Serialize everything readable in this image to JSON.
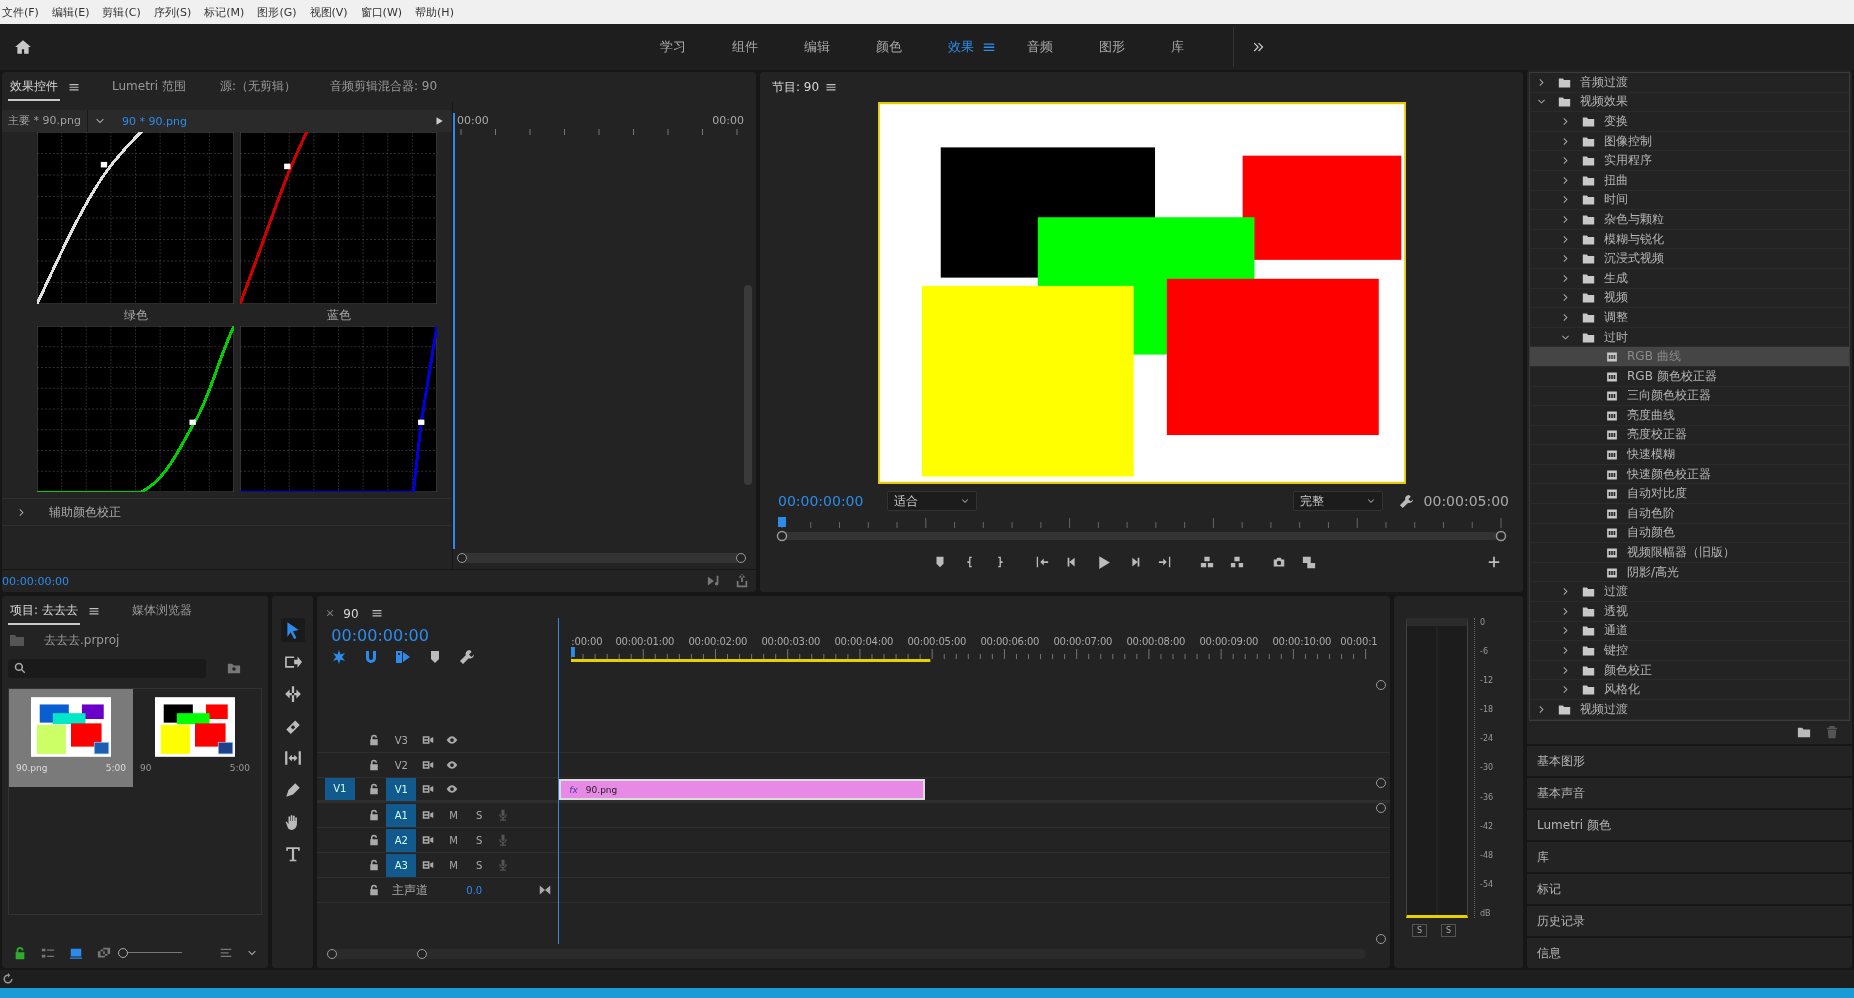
{
  "menu": [
    "文件(F)",
    "编辑(E)",
    "剪辑(C)",
    "序列(S)",
    "标记(M)",
    "图形(G)",
    "视图(V)",
    "窗口(W)",
    "帮助(H)"
  ],
  "workspaces": [
    {
      "label": "学习",
      "selected": false
    },
    {
      "label": "组件",
      "selected": false
    },
    {
      "label": "编辑",
      "selected": false
    },
    {
      "label": "颜色",
      "selected": false
    },
    {
      "label": "效果",
      "selected": true
    },
    {
      "label": "音频",
      "selected": false
    },
    {
      "label": "图形",
      "selected": false
    },
    {
      "label": "库",
      "selected": false
    }
  ],
  "effect_controls": {
    "tabs": [
      {
        "label": "效果控件",
        "selected": true
      },
      {
        "label": "Lumetri 范围",
        "selected": false
      },
      {
        "label": "源:（无剪辑）",
        "selected": false
      },
      {
        "label": "音频剪辑混合器: 90",
        "selected": false
      }
    ],
    "master_clip": "主要 * 90.png",
    "sequence_clip": "90 * 90.png",
    "ruler_start": "00:00",
    "ruler_end": "00:00",
    "curves": [
      {
        "kind": "master",
        "color": "#e0e0e0"
      },
      {
        "kind": "red",
        "color": "#d00000"
      },
      {
        "kind": "green",
        "label": "绿色",
        "color": "#00d000"
      },
      {
        "kind": "blue",
        "label": "蓝色",
        "color": "#0000e0"
      }
    ],
    "section": {
      "label": "辅助颜色校正",
      "expanded": false
    },
    "timecode": "00:00:00:00"
  },
  "program": {
    "title": "节目: 90",
    "timecode": "00:00:00:00",
    "zoom": "适合",
    "quality": "完整",
    "duration": "00:00:05:00"
  },
  "effects": {
    "tree": [
      {
        "label": "音频过渡",
        "kind": "folder",
        "expanded": false,
        "selected": false
      },
      {
        "label": "视频效果",
        "kind": "folder",
        "expanded": true,
        "selected": false,
        "children": [
          {
            "label": "变换",
            "kind": "folder",
            "expanded": false,
            "selected": false
          },
          {
            "label": "图像控制",
            "kind": "folder",
            "expanded": false,
            "selected": false
          },
          {
            "label": "实用程序",
            "kind": "folder",
            "expanded": false,
            "selected": false
          },
          {
            "label": "扭曲",
            "kind": "folder",
            "expanded": false,
            "selected": false
          },
          {
            "label": "时间",
            "kind": "folder",
            "expanded": false,
            "selected": false
          },
          {
            "label": "杂色与颗粒",
            "kind": "folder",
            "expanded": false,
            "selected": false
          },
          {
            "label": "模糊与锐化",
            "kind": "folder",
            "expanded": false,
            "selected": false
          },
          {
            "label": "沉浸式视频",
            "kind": "folder",
            "expanded": false,
            "selected": false
          },
          {
            "label": "生成",
            "kind": "folder",
            "expanded": false,
            "selected": false
          },
          {
            "label": "视频",
            "kind": "folder",
            "expanded": false,
            "selected": false
          },
          {
            "label": "调整",
            "kind": "folder",
            "expanded": false,
            "selected": false
          },
          {
            "label": "过时",
            "kind": "folder",
            "expanded": true,
            "selected": false,
            "children": [
              {
                "label": "RGB 曲线",
                "kind": "effect",
                "selected": true
              },
              {
                "label": "RGB 颜色校正器",
                "kind": "effect",
                "selected": false
              },
              {
                "label": "三向颜色校正器",
                "kind": "effect",
                "selected": false
              },
              {
                "label": "亮度曲线",
                "kind": "effect",
                "selected": false
              },
              {
                "label": "亮度校正器",
                "kind": "effect",
                "selected": false
              },
              {
                "label": "快速模糊",
                "kind": "effect",
                "selected": false
              },
              {
                "label": "快速颜色校正器",
                "kind": "effect",
                "selected": false
              },
              {
                "label": "自动对比度",
                "kind": "effect",
                "selected": false
              },
              {
                "label": "自动色阶",
                "kind": "effect",
                "selected": false
              },
              {
                "label": "自动颜色",
                "kind": "effect",
                "selected": false
              },
              {
                "label": "视频限幅器（旧版）",
                "kind": "effect",
                "selected": false
              },
              {
                "label": "阴影/高光",
                "kind": "effect",
                "selected": false
              }
            ]
          },
          {
            "label": "过渡",
            "kind": "folder",
            "expanded": false,
            "selected": false
          },
          {
            "label": "透视",
            "kind": "folder",
            "expanded": false,
            "selected": false
          },
          {
            "label": "通道",
            "kind": "folder",
            "expanded": false,
            "selected": false
          },
          {
            "label": "键控",
            "kind": "folder",
            "expanded": false,
            "selected": false
          },
          {
            "label": "颜色校正",
            "kind": "folder",
            "expanded": false,
            "selected": false
          },
          {
            "label": "风格化",
            "kind": "folder",
            "expanded": false,
            "selected": false
          }
        ]
      },
      {
        "label": "视频过渡",
        "kind": "folder",
        "expanded": false,
        "selected": false
      }
    ]
  },
  "panels": [
    "基本图形",
    "基本声音",
    "Lumetri 颜色",
    "库",
    "标记",
    "历史记录",
    "信息"
  ],
  "project": {
    "tabs": [
      {
        "label": "项目: 去去去",
        "selected": true
      },
      {
        "label": "媒体浏览器",
        "selected": false
      }
    ],
    "file": "去去去.prproj",
    "zoom": {
      "level": 0
    },
    "items": [
      {
        "name": "90.png",
        "duration": "5:00",
        "kind": "clip",
        "selected": true
      },
      {
        "name": "90",
        "duration": "5:00",
        "kind": "sequence",
        "selected": false
      }
    ]
  },
  "timeline": {
    "title": "90",
    "timecode": "00:00:00:00",
    "ruler": [
      ":00:00",
      "00:00:01:00",
      "00:00:02:00",
      "00:00:03:00",
      "00:00:04:00",
      "00:00:05:00",
      "00:00:06:00",
      "00:00:07:00",
      "00:00:08:00",
      "00:00:09:00",
      "00:00:10:00",
      "00:00:1"
    ],
    "tracks": [
      {
        "kind": "video",
        "name": "V3",
        "targeted": false
      },
      {
        "kind": "video",
        "name": "V2",
        "targeted": false
      },
      {
        "kind": "video",
        "name": "V1",
        "source": "V1",
        "targeted": true,
        "clip": {
          "name": "90.png",
          "badge": "fx"
        }
      },
      {
        "kind": "audio",
        "name": "A1",
        "targeted": true,
        "mute": "M",
        "solo": "S"
      },
      {
        "kind": "audio",
        "name": "A2",
        "targeted": true,
        "mute": "M",
        "solo": "S"
      },
      {
        "kind": "audio",
        "name": "A3",
        "targeted": true,
        "mute": "M",
        "solo": "S"
      },
      {
        "kind": "master",
        "name": "主声道",
        "value": "0.0"
      }
    ]
  },
  "meter": {
    "scale": [
      "0",
      "-6",
      "-12",
      "-18",
      "-24",
      "-30",
      "-36",
      "-42",
      "-48",
      "-54",
      "dB"
    ],
    "solo": [
      "S",
      "S"
    ]
  }
}
